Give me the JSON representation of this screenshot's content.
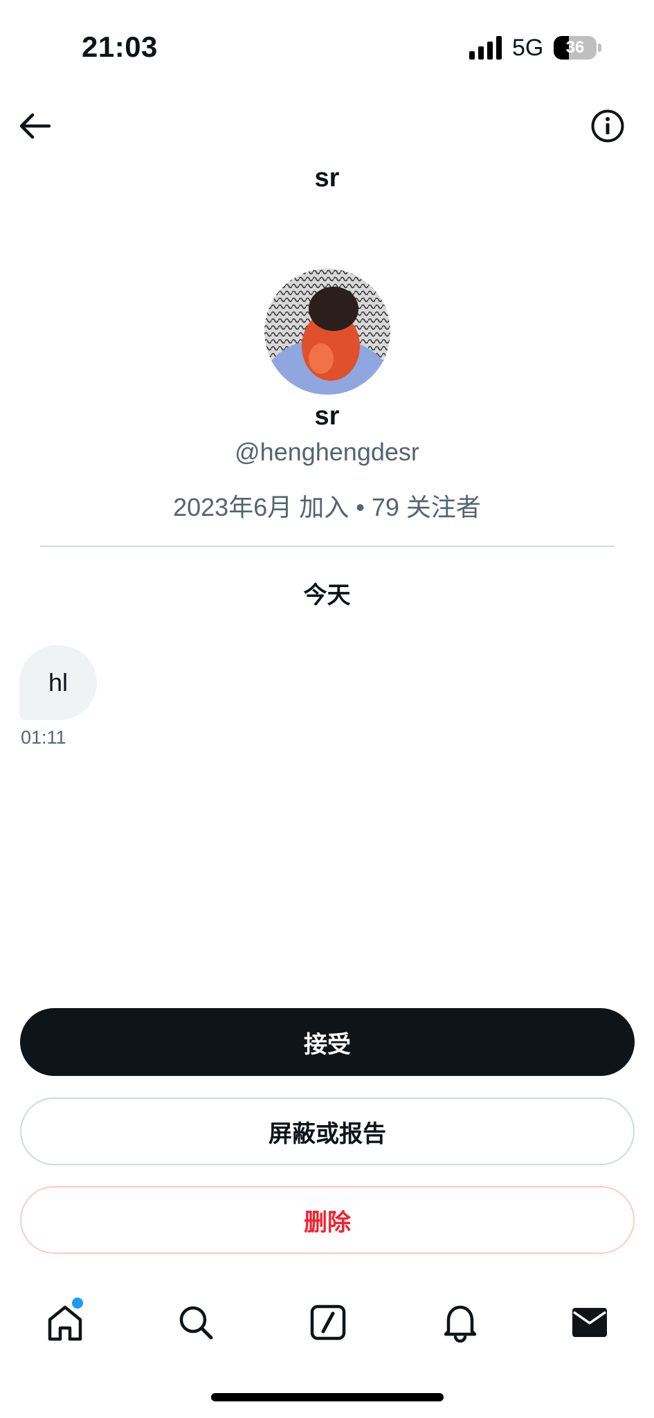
{
  "status_bar": {
    "time": "21:03",
    "network": "5G",
    "battery_text": "36",
    "battery_level": 36
  },
  "header": {
    "title": "sr"
  },
  "profile": {
    "name": "sr",
    "handle": "@henghengdesr",
    "meta": "2023年6月 加入 • 79 关注者"
  },
  "conversation": {
    "date_separator": "今天",
    "messages": [
      {
        "text": "hl",
        "time": "01:11"
      }
    ]
  },
  "actions": {
    "accept_label": "接受",
    "block_report_label": "屏蔽或报告",
    "delete_label": "删除"
  },
  "colors": {
    "primary_text": "#0f1419",
    "secondary_text": "#536471",
    "accent_blue": "#1d9bf0",
    "danger_red": "#f4212e",
    "border": "#cfd9de"
  },
  "tabs": [
    {
      "icon": "home-icon",
      "has_badge": true
    },
    {
      "icon": "search-icon"
    },
    {
      "icon": "compose-icon"
    },
    {
      "icon": "bell-icon"
    },
    {
      "icon": "mail-icon",
      "active": true
    }
  ]
}
